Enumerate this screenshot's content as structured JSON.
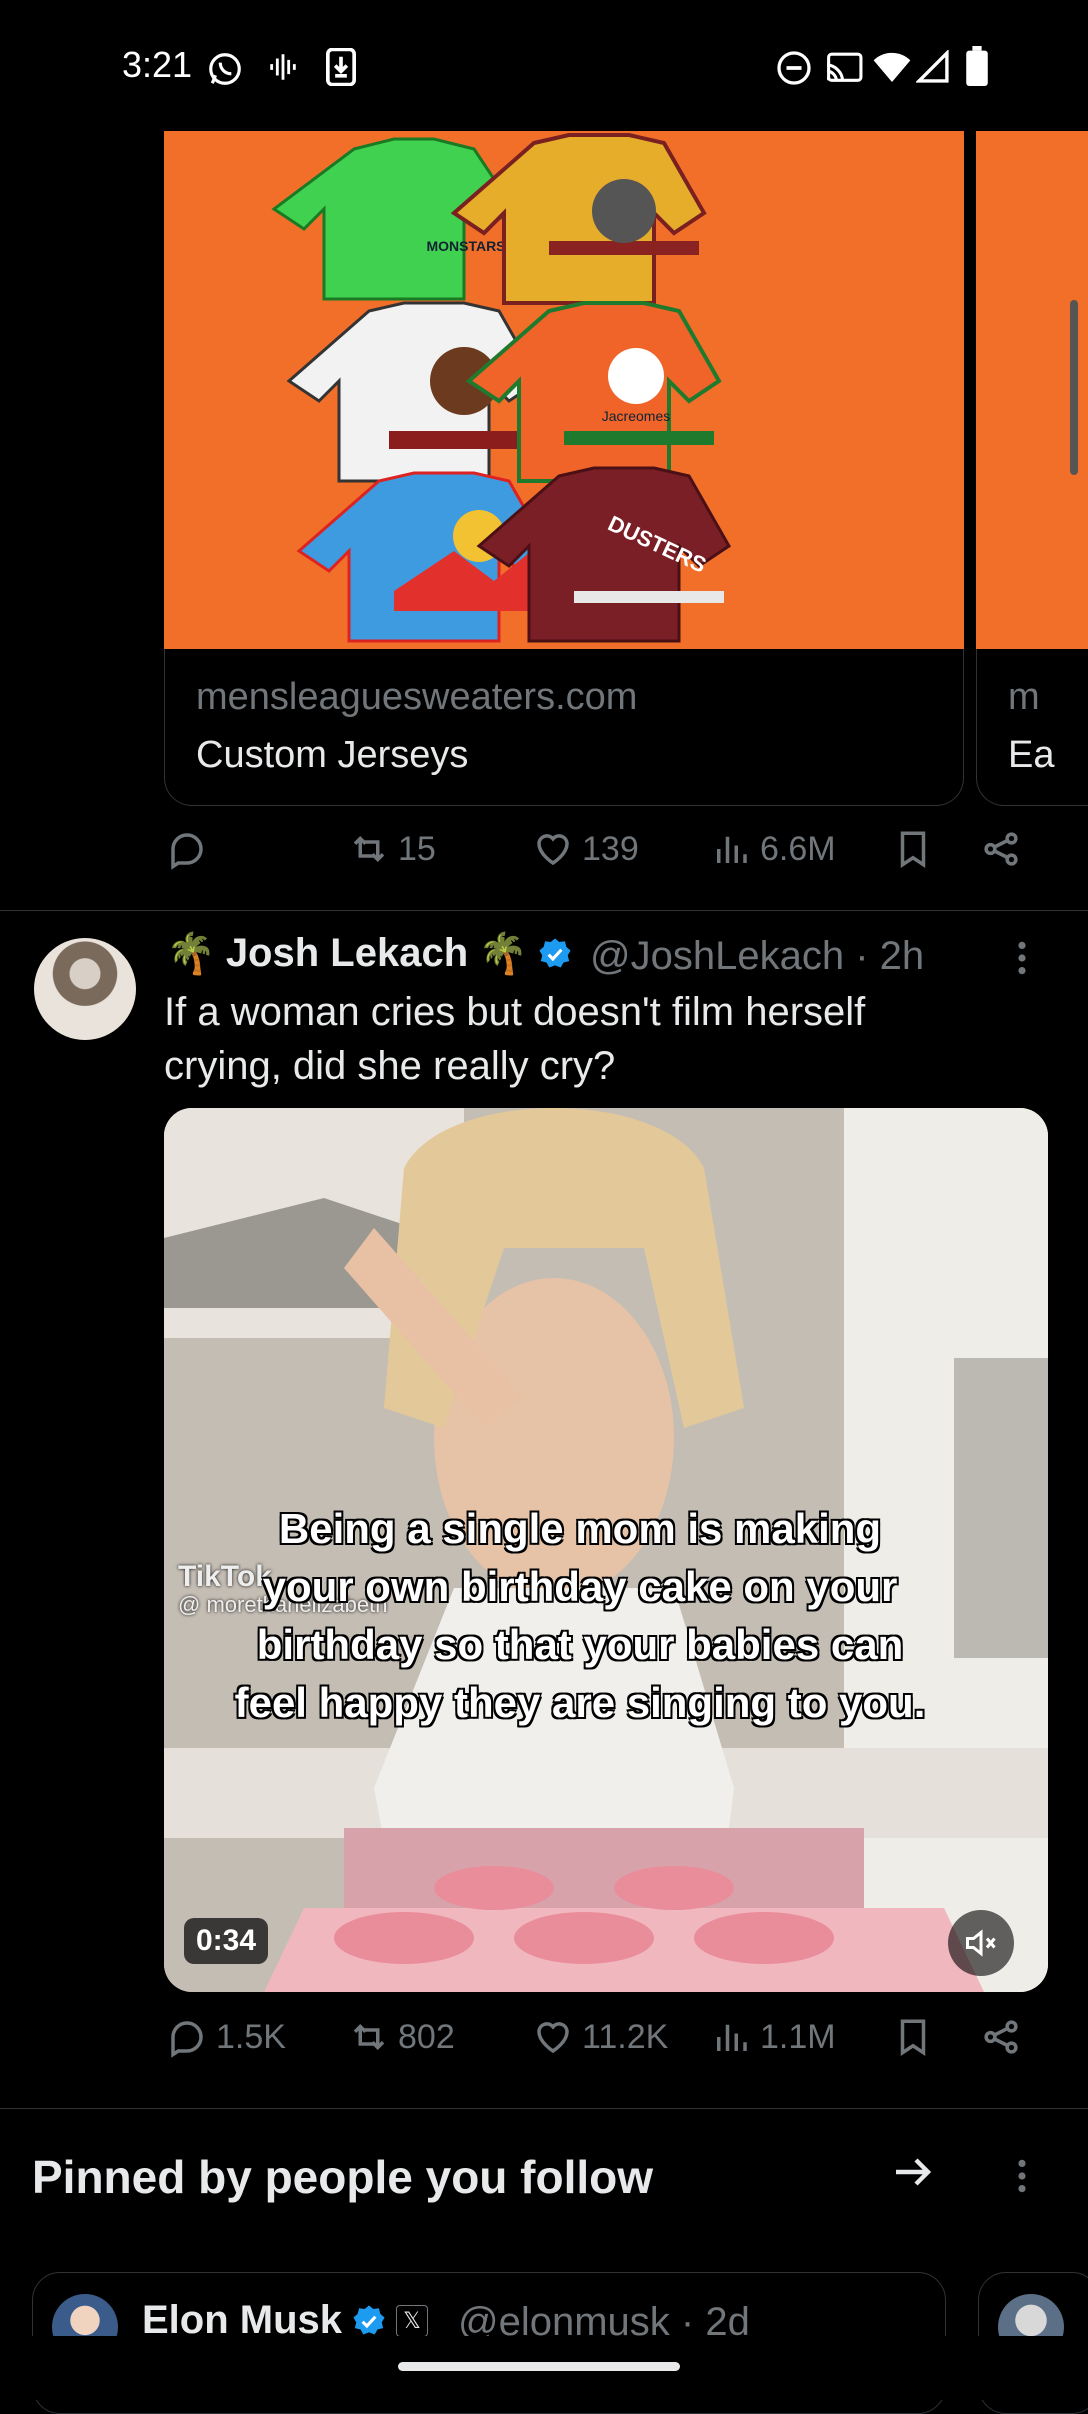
{
  "status_bar": {
    "time": "3:21",
    "left_icons": [
      "whatsapp-icon",
      "voice-icon",
      "download-icon"
    ],
    "right_icons": [
      "dnd-icon",
      "cast-icon",
      "wifi-icon",
      "signal-icon",
      "battery-icon"
    ]
  },
  "link_card": {
    "domain": "mensleaguesweaters.com",
    "title": "Custom Jerseys",
    "jersey_texts": [
      "MONSTARS",
      "Jacreomes",
      "DUSTERS"
    ],
    "peek_domain": "m",
    "peek_title": "Ea"
  },
  "tweet1_actions": {
    "replies": "",
    "retweets": "15",
    "likes": "139",
    "views": "6.6M"
  },
  "tweet2": {
    "name": "Josh Lekach",
    "name_emoji": "🌴",
    "handle": "@JoshLekach",
    "time": "· 2h",
    "text": "If a woman cries but doesn't film herself crying, did she really cry?",
    "media": {
      "caption": "Being a single mom is making your own birthday cake on your birthday so that your babies can feel happy they are singing to you.",
      "tiktok_label": "TikTok",
      "tiktok_user": "@ morethanelizabeth",
      "duration": "0:34"
    },
    "actions": {
      "replies": "1.5K",
      "retweets": "802",
      "likes": "11.2K",
      "views": "1.1M"
    }
  },
  "pinned": {
    "title": "Pinned by people you follow",
    "card": {
      "name": "Elon Musk",
      "badge": "𝕏",
      "handle": "@elonmusk · 2d"
    }
  },
  "colors": {
    "background": "#000000",
    "text": "#e7e9ea",
    "muted": "#71767b",
    "verified": "#1d9bf0",
    "card_orange": "#f26f2a"
  }
}
